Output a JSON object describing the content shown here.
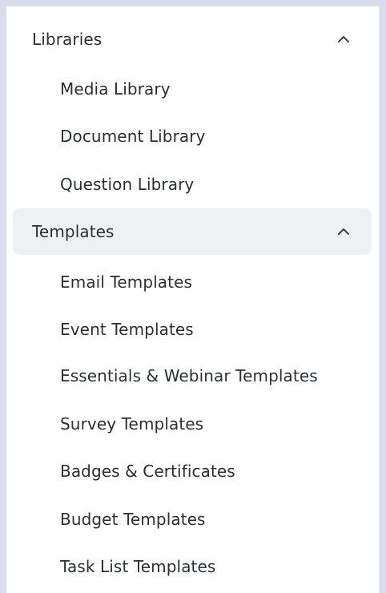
{
  "sections": [
    {
      "title": "Libraries",
      "expanded": true,
      "items": [
        "Media Library",
        "Document Library",
        "Question Library"
      ]
    },
    {
      "title": "Templates",
      "expanded": true,
      "items": [
        "Email Templates",
        "Event Templates",
        "Essentials & Webinar Templates",
        "Survey Templates",
        "Badges & Certificates",
        "Budget Templates",
        "Task List Templates"
      ]
    }
  ],
  "colors": {
    "page_bg": "#d9dcec",
    "panel_bg": "#ffffff",
    "active_header_bg": "#eef0f3",
    "text": "#2b2f36"
  },
  "icons": {
    "collapse": "chevron-up-icon"
  }
}
